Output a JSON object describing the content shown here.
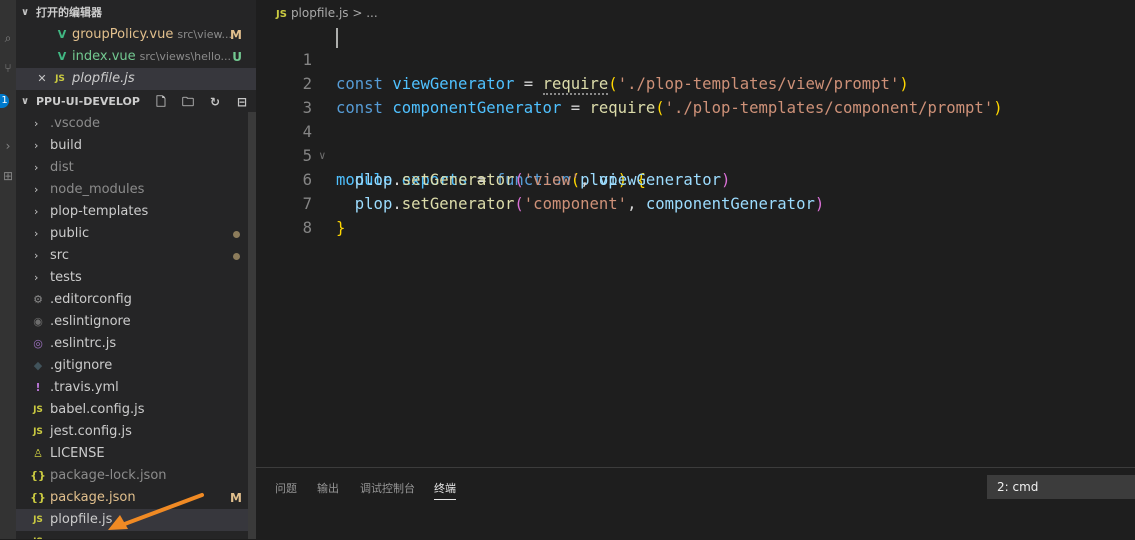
{
  "open_editors": {
    "header": "打开的编辑器",
    "items": [
      {
        "name": "groupPolicy.vue",
        "path": "src\\view...",
        "badge": "M"
      },
      {
        "name": "index.vue",
        "path": "src\\views\\hello...",
        "badge": "U"
      },
      {
        "name": "plopfile.js",
        "close": "✕"
      }
    ]
  },
  "explorer": {
    "header": "PPU-UI-DEVELOP",
    "folders": [
      ".vscode",
      "build",
      "dist",
      "node_modules",
      "plop-templates",
      "public",
      "src",
      "tests"
    ],
    "files": [
      ".editorconfig",
      ".eslintignore",
      ".eslintrc.js",
      ".gitignore",
      ".travis.yml",
      "babel.config.js",
      "jest.config.js",
      "LICENSE",
      "package-lock.json",
      "package.json",
      "plopfile.js"
    ],
    "package_json_badge": "M"
  },
  "breadcrumb": {
    "file": "plopfile.js",
    "rest": "> ..."
  },
  "editor": {
    "line_numbers": [
      "1",
      "2",
      "3",
      "4",
      "5",
      "6",
      "7",
      "8"
    ],
    "code": {
      "l1_const": "const",
      "l1_var": "viewGenerator",
      "l1_eq": " = ",
      "l1_fn": "require",
      "l1_str": "'./plop-templates/view/prompt'",
      "l2_const": "const",
      "l2_var": "componentGenerator",
      "l2_eq": " = ",
      "l2_fn": "require",
      "l2_str": "'./plop-templates/component/prompt'",
      "l4_module": "module",
      "l4_exports": "exports",
      "l4_eq": " = ",
      "l4_function": "function",
      "l4_param": "plop",
      "l5_plop": "plop",
      "l5_method": "setGenerator",
      "l5_str": "'view'",
      "l5_arg": "viewGenerator",
      "l6_plop": "plop",
      "l6_method": "setGenerator",
      "l6_str": "'component'",
      "l6_arg": "componentGenerator"
    }
  },
  "panel": {
    "tabs": [
      "问题",
      "输出",
      "调试控制台",
      "终端"
    ],
    "active_tab": "终端",
    "terminal_select": "2: cmd"
  }
}
